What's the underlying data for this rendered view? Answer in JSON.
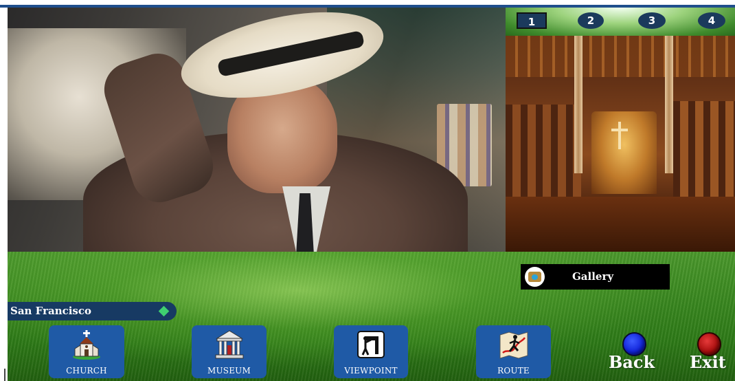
{
  "video": {
    "label": ""
  },
  "image_tabs": [
    "1",
    "2",
    "3",
    "4"
  ],
  "selected_tab": "1",
  "gallery": {
    "label": "Gallery",
    "icon": "gallery-icon"
  },
  "location": {
    "name": "San Francisco"
  },
  "nav": {
    "church": {
      "label": "CHURCH",
      "icon": "church-icon"
    },
    "museum": {
      "label": "MUSEUM",
      "icon": "museum-icon"
    },
    "viewpoint": {
      "label": "VIEWPOINT",
      "icon": "viewpoint-icon"
    },
    "route": {
      "label": "ROUTE",
      "icon": "route-icon"
    }
  },
  "back": {
    "label": "Back"
  },
  "exit": {
    "label": "Exit"
  },
  "colors": {
    "nav_button": "#1f5aa6",
    "location_bar": "#173a63",
    "back_button": "#1022d8",
    "exit_button": "#a50c0c",
    "tab": "#1b3a5c"
  }
}
